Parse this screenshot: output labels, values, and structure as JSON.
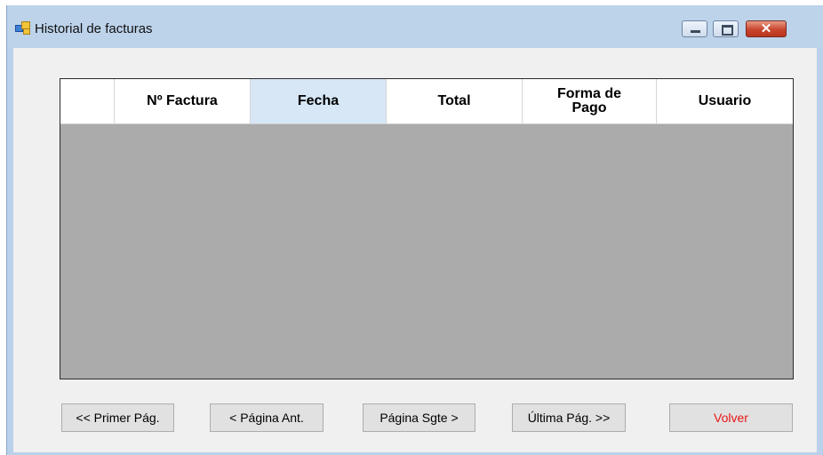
{
  "window": {
    "title": "Historial de facturas",
    "controls": {
      "minimize": "minimize",
      "maximize": "maximize",
      "close": "✕"
    }
  },
  "grid": {
    "columns": [
      "",
      "Nº Factura",
      "Fecha",
      "Total",
      "Forma de Pago",
      "Usuario"
    ],
    "selected_column": "Fecha",
    "rows": []
  },
  "buttons": {
    "first_page": "<< Primer Pág.",
    "prev_page": "< Página Ant.",
    "next_page": "Página Sgte >",
    "last_page": "Última Pág. >>",
    "back": "Volver"
  },
  "colors": {
    "back_text": "#e81414",
    "grid_empty": "#ababab",
    "selected_header": "#d7e7f6"
  }
}
